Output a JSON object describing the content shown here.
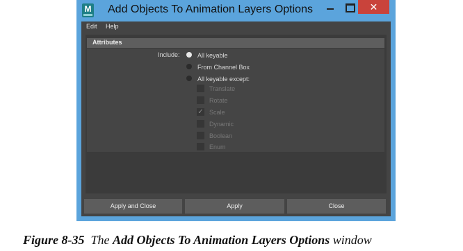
{
  "window": {
    "title": "Add Objects To Animation Layers Options",
    "app_icon_letter": "M",
    "close_glyph": "✕"
  },
  "menu": {
    "items": [
      {
        "label": "Edit"
      },
      {
        "label": "Help"
      }
    ]
  },
  "attributes": {
    "header": "Attributes",
    "include_label": "Include:",
    "options": [
      {
        "label": "All keyable",
        "selected": true
      },
      {
        "label": "From Channel Box",
        "selected": false
      },
      {
        "label": "All keyable except:",
        "selected": false
      }
    ],
    "except_items": [
      {
        "label": "Translate",
        "checked": false
      },
      {
        "label": "Rotate",
        "checked": false
      },
      {
        "label": "Scale",
        "checked": true
      },
      {
        "label": "Dynamic",
        "checked": false
      },
      {
        "label": "Boolean",
        "checked": false
      },
      {
        "label": "Enum",
        "checked": false
      }
    ],
    "check_glyph": "✓"
  },
  "buttons": {
    "apply_close": "Apply and Close",
    "apply": "Apply",
    "close": "Close"
  },
  "caption": {
    "figure": "Figure 8-35",
    "the": "The",
    "name": "Add Objects To Animation Layers Options",
    "suffix": "window"
  }
}
